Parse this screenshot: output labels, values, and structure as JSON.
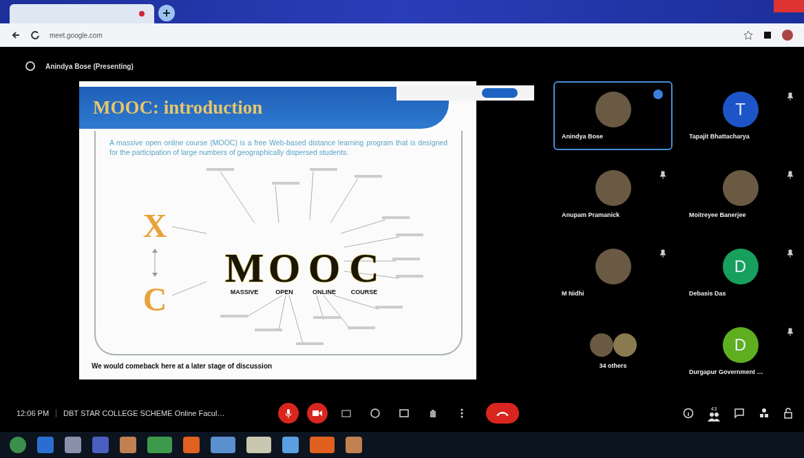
{
  "browser": {
    "url": "meet.google.com"
  },
  "presenter_label": "Anindya Bose (Presenting)",
  "slide": {
    "title": "MOOC: introduction",
    "body": "A massive open online course (MOOC) is a free Web-based distance learning program that is designed for the participation of large numbers of geographically dispersed students.",
    "diagram": {
      "letters": [
        {
          "letter": "M",
          "word": "MASSIVE"
        },
        {
          "letter": "O",
          "word": "OPEN"
        },
        {
          "letter": "O",
          "word": "ONLINE"
        },
        {
          "letter": "C",
          "word": "COURSE"
        }
      ],
      "side_letters": [
        "X",
        "C"
      ]
    },
    "footer": "We would comeback here at a later stage of discussion"
  },
  "participants": [
    {
      "name": "Anindya Bose",
      "kind": "photo",
      "selected": true,
      "speaking": true
    },
    {
      "name": "Tapajit Bhattacharya",
      "kind": "initial",
      "initial": "T",
      "color": "#1d55c8",
      "selected": false,
      "speaking": false
    },
    {
      "name": "Anupam Pramanick",
      "kind": "photo",
      "selected": false,
      "speaking": false
    },
    {
      "name": "Moitreyee Banerjee",
      "kind": "photo",
      "selected": false,
      "speaking": false
    },
    {
      "name": "M Nidhi",
      "kind": "photo",
      "selected": false,
      "speaking": false
    },
    {
      "name": "Debasis Das",
      "kind": "initial",
      "initial": "D",
      "color": "#17a05d",
      "selected": false,
      "speaking": false
    },
    {
      "name": "34 others",
      "kind": "group",
      "selected": false,
      "speaking": false
    },
    {
      "name": "Durgapur Government …",
      "kind": "initial",
      "initial": "D",
      "color": "#5fae1f",
      "selected": false,
      "speaking": false
    }
  ],
  "controls": {
    "time": "12:06 PM",
    "meeting_title": "DBT STAR COLLEGE SCHEME Online Facul…",
    "mic_on": false,
    "camera_on": false,
    "participant_count": "43"
  }
}
